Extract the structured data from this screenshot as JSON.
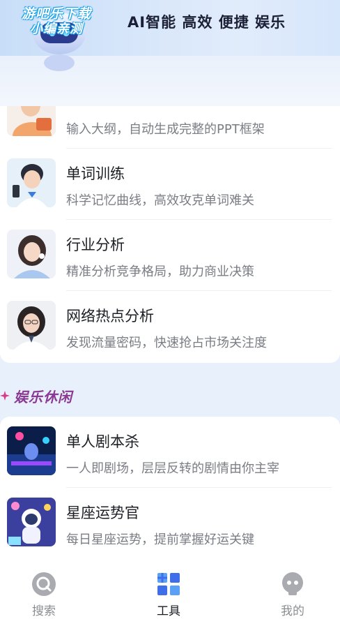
{
  "banner": {
    "watermark_line1": "游吧乐下载",
    "watermark_line2": "小编亲测",
    "tagline": "AI智能 高效 便捷 娱乐"
  },
  "tools_list": [
    {
      "title": "",
      "desc": "输入大纲，自动生成完整的PPT框架",
      "thumb": "ppt-assistant-girl"
    },
    {
      "title": "单词训练",
      "desc": "科学记忆曲线，高效攻克单词难关",
      "thumb": "word-training-girl"
    },
    {
      "title": "行业分析",
      "desc": "精准分析竞争格局，助力商业决策",
      "thumb": "industry-analysis-girl"
    },
    {
      "title": "网络热点分析",
      "desc": "发现流量密码，快速抢占市场关注度",
      "thumb": "hot-topic-girl"
    }
  ],
  "entertainment": {
    "section_title": "娱乐休闲",
    "accent_color": "#d23c8c",
    "items": [
      {
        "title": "单人剧本杀",
        "desc": "一人即剧场，层层反转的剧情由你主宰",
        "thumb": "murder-mystery-scene"
      },
      {
        "title": "星座运势官",
        "desc": "每日星座运势，提前掌握好运关键",
        "thumb": "astronaut-horoscope"
      }
    ]
  },
  "tabbar": {
    "active": "tools",
    "active_color": "#3f6fe8",
    "inactive_color": "#9a9ca3",
    "tabs": [
      {
        "label": "搜索",
        "icon": "search-icon"
      },
      {
        "label": "工具",
        "icon": "tools-grid-icon"
      },
      {
        "label": "我的",
        "icon": "profile-face-icon"
      }
    ]
  }
}
